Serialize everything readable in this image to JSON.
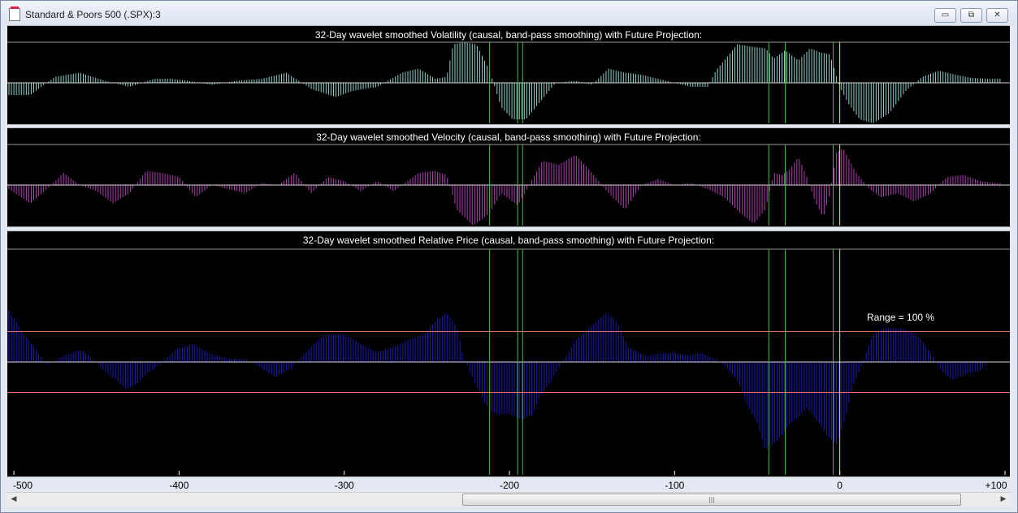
{
  "window": {
    "title": "Standard & Poors 500 (.SPX):3",
    "controls": {
      "minimize": "▭",
      "restore": "⧉",
      "close": "✕"
    }
  },
  "panels": [
    {
      "title": "32-Day wavelet smoothed Volatility (causal, band-pass smoothing) with Future Projection:",
      "color": "#8fd3cf"
    },
    {
      "title": "32-Day wavelet smoothed Velocity (causal, band-pass smoothing) with Future Projection:",
      "color": "#b13fb3"
    },
    {
      "title": "32-Day wavelet smoothed Relative Price (causal, band-pass smoothing) with Future Projection:",
      "color": "#1a1ab4"
    }
  ],
  "range_label": "Range = 100 %",
  "x_axis": {
    "ticks": [
      -500,
      -400,
      -300,
      -200,
      -100,
      0,
      100
    ],
    "tick_labels": [
      "-500",
      "-400",
      "-300",
      "-200",
      "-100",
      "0",
      "+100"
    ],
    "min": -503,
    "max": 101
  },
  "vertical_markers": [
    -212,
    -195,
    -192,
    -43,
    -33,
    -4,
    0
  ],
  "marker_colors": {
    "green": "#3ec23e",
    "now": "#e8e880"
  },
  "chart_data": [
    {
      "type": "bar",
      "title": "32-Day wavelet smoothed Volatility (causal, band-pass smoothing) with Future Projection:",
      "ylim": [
        -1,
        1
      ],
      "x": [
        -503,
        -490,
        -475,
        -460,
        -445,
        -430,
        -415,
        -405,
        -395,
        -380,
        -365,
        -350,
        -335,
        -320,
        -305,
        -295,
        -280,
        -265,
        -255,
        -245,
        -238,
        -234,
        -228,
        -220,
        -212,
        -205,
        -198,
        -190,
        -180,
        -172,
        -160,
        -150,
        -140,
        -130,
        -120,
        -110,
        -100,
        -90,
        -80,
        -75,
        -65,
        -62,
        -55,
        -45,
        -40,
        -33,
        -25,
        -18,
        -12,
        -6,
        0,
        5,
        12,
        20,
        30,
        40,
        50,
        60,
        70,
        80,
        90,
        100
      ],
      "y": [
        -0.3,
        -0.3,
        0.15,
        0.25,
        0.05,
        -0.1,
        0.1,
        0.1,
        0.05,
        -0.05,
        0.05,
        0.1,
        0.25,
        -0.15,
        -0.35,
        -0.2,
        -0.1,
        0.25,
        0.35,
        0.1,
        0.15,
        0.95,
        1,
        0.95,
        0.3,
        -0.6,
        -0.9,
        -0.9,
        -0.4,
        0.0,
        0.05,
        -0.05,
        0.35,
        0.25,
        0.2,
        0.1,
        0.0,
        -0.1,
        -0.1,
        0.3,
        0.8,
        0.95,
        0.9,
        0.85,
        0.6,
        0.8,
        0.55,
        0.85,
        0.75,
        0.7,
        -0.1,
        -0.5,
        -0.9,
        -1,
        -0.75,
        -0.2,
        0.15,
        0.3,
        0.2,
        0.12,
        0.1,
        0.1
      ]
    },
    {
      "type": "bar",
      "title": "32-Day wavelet smoothed Velocity (causal, band-pass smoothing) with Future Projection:",
      "ylim": [
        -1,
        1
      ],
      "x": [
        -503,
        -490,
        -480,
        -470,
        -460,
        -450,
        -440,
        -430,
        -420,
        -410,
        -400,
        -390,
        -380,
        -370,
        -360,
        -350,
        -340,
        -330,
        -320,
        -310,
        -300,
        -290,
        -280,
        -270,
        -255,
        -245,
        -238,
        -232,
        -222,
        -212,
        -205,
        -195,
        -188,
        -180,
        -170,
        -160,
        -150,
        -140,
        -130,
        -120,
        -110,
        -100,
        -90,
        -80,
        -70,
        -60,
        -52,
        -45,
        -40,
        -35,
        -30,
        -25,
        -20,
        -15,
        -10,
        -6,
        -2,
        2,
        10,
        18,
        25,
        35,
        45,
        55,
        65,
        75,
        85,
        95,
        100
      ],
      "y": [
        -0.1,
        -0.45,
        -0.1,
        0.3,
        0.0,
        -0.15,
        -0.45,
        -0.2,
        0.35,
        0.3,
        0.2,
        -0.3,
        0.0,
        -0.1,
        -0.2,
        0.05,
        0.0,
        0.3,
        -0.2,
        0.2,
        0.1,
        -0.15,
        0.1,
        -0.15,
        0.3,
        0.35,
        0.25,
        -0.6,
        -1,
        -0.7,
        -0.2,
        -0.5,
        0.0,
        0.6,
        0.5,
        0.75,
        0.3,
        -0.2,
        -0.6,
        0.0,
        0.15,
        0.0,
        0.05,
        -0.1,
        -0.3,
        -0.7,
        -0.95,
        -0.6,
        0.3,
        0.25,
        0.4,
        0.7,
        0.2,
        -0.4,
        -0.8,
        -0.2,
        0.8,
        0.9,
        0.3,
        -0.1,
        -0.3,
        -0.2,
        -0.4,
        -0.2,
        0.2,
        0.25,
        0.1,
        0.05,
        0.05
      ]
    },
    {
      "type": "area",
      "title": "32-Day wavelet smoothed Relative Price (causal, band-pass smoothing) with Future Projection:",
      "ylim": [
        -1,
        1
      ],
      "reference_lines": [
        0.5,
        -0.5
      ],
      "x": [
        -503,
        -495,
        -488,
        -480,
        -470,
        -460,
        -452,
        -445,
        -438,
        -432,
        -425,
        -420,
        -412,
        -402,
        -392,
        -382,
        -370,
        -360,
        -350,
        -342,
        -332,
        -322,
        -312,
        -300,
        -290,
        -280,
        -270,
        -262,
        -252,
        -244,
        -238,
        -232,
        -228,
        -220,
        -213,
        -208,
        -200,
        -192,
        -186,
        -182,
        -176,
        -168,
        -160,
        -150,
        -142,
        -138,
        -134,
        -128,
        -122,
        -116,
        -108,
        -100,
        -92,
        -84,
        -75,
        -68,
        -62,
        -56,
        -50,
        -45,
        -40,
        -35,
        -30,
        -25,
        -20,
        -14,
        -8,
        -2,
        3,
        8,
        14,
        20,
        26,
        32,
        38,
        44,
        50,
        56,
        62,
        68,
        76,
        84,
        90
      ],
      "y": [
        0.85,
        0.5,
        0.25,
        -0.05,
        0.1,
        0.2,
        0.05,
        -0.15,
        -0.3,
        -0.45,
        -0.35,
        -0.2,
        -0.05,
        0.2,
        0.3,
        0.15,
        0.05,
        0.05,
        -0.1,
        -0.25,
        -0.1,
        0.2,
        0.45,
        0.45,
        0.3,
        0.15,
        0.25,
        0.35,
        0.45,
        0.7,
        0.8,
        0.6,
        0.1,
        -0.4,
        -0.75,
        -0.85,
        -0.85,
        -0.95,
        -0.85,
        -0.6,
        -0.35,
        0.0,
        0.35,
        0.6,
        0.8,
        0.75,
        0.6,
        0.25,
        0.15,
        0.1,
        0.15,
        0.15,
        0.1,
        0.15,
        0.05,
        -0.1,
        -0.3,
        -0.7,
        -1.0,
        -1.45,
        -1.35,
        -1.2,
        -1.0,
        -0.9,
        -0.75,
        -0.95,
        -1.2,
        -1.35,
        -0.95,
        -0.4,
        0.0,
        0.45,
        0.55,
        0.55,
        0.55,
        0.5,
        0.35,
        0.1,
        -0.15,
        -0.3,
        -0.2,
        -0.15,
        0.0
      ]
    }
  ]
}
